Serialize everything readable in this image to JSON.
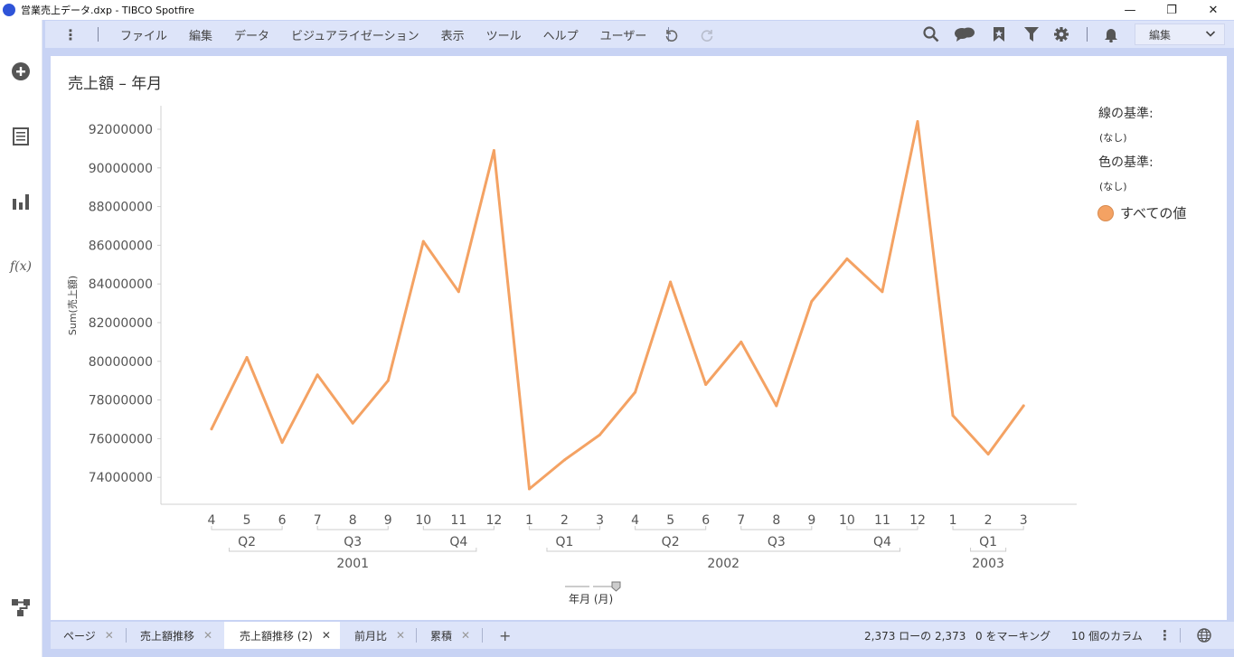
{
  "window": {
    "title": "営業売上データ.dxp - TIBCO Spotfire",
    "controls": [
      "—",
      "❐",
      "✕"
    ]
  },
  "sidebar": {
    "icons": [
      "add-icon",
      "data-table-icon",
      "visualization-icon",
      "expression-icon",
      "data-canvas-icon"
    ],
    "fx_label": "f(x)"
  },
  "menu": {
    "kebab": "⋮",
    "items": [
      "ファイル",
      "編集",
      "データ",
      "ビジュアライゼーション",
      "表示",
      "ツール",
      "ヘルプ",
      "ユーザー"
    ],
    "edit_mode": "編集"
  },
  "visualization": {
    "title": "売上額 – 年月",
    "color_accent": "#f4a263",
    "legend": {
      "line_by_label": "線の基準:",
      "line_by_value": "(なし)",
      "color_by_label": "色の基準:",
      "color_by_value": "(なし)",
      "item_label": "すべての値"
    },
    "axis_selector_label": "年月 (月)"
  },
  "chart_data": {
    "type": "line",
    "title": "売上額 – 年月",
    "ylabel": "Sum(売上額)",
    "xlabel": "年月 (月)",
    "ylim": [
      72500000,
      93500000
    ],
    "yticks": [
      74000000,
      76000000,
      78000000,
      80000000,
      82000000,
      84000000,
      86000000,
      88000000,
      90000000,
      92000000
    ],
    "x": [
      {
        "year": "2001",
        "quarter": "Q2",
        "month": "4"
      },
      {
        "year": "2001",
        "quarter": "Q2",
        "month": "5"
      },
      {
        "year": "2001",
        "quarter": "Q2",
        "month": "6"
      },
      {
        "year": "2001",
        "quarter": "Q3",
        "month": "7"
      },
      {
        "year": "2001",
        "quarter": "Q3",
        "month": "8"
      },
      {
        "year": "2001",
        "quarter": "Q3",
        "month": "9"
      },
      {
        "year": "2001",
        "quarter": "Q4",
        "month": "10"
      },
      {
        "year": "2001",
        "quarter": "Q4",
        "month": "11"
      },
      {
        "year": "2001",
        "quarter": "Q4",
        "month": "12"
      },
      {
        "year": "2002",
        "quarter": "Q1",
        "month": "1"
      },
      {
        "year": "2002",
        "quarter": "Q1",
        "month": "2"
      },
      {
        "year": "2002",
        "quarter": "Q1",
        "month": "3"
      },
      {
        "year": "2002",
        "quarter": "Q2",
        "month": "4"
      },
      {
        "year": "2002",
        "quarter": "Q2",
        "month": "5"
      },
      {
        "year": "2002",
        "quarter": "Q2",
        "month": "6"
      },
      {
        "year": "2002",
        "quarter": "Q3",
        "month": "7"
      },
      {
        "year": "2002",
        "quarter": "Q3",
        "month": "8"
      },
      {
        "year": "2002",
        "quarter": "Q3",
        "month": "9"
      },
      {
        "year": "2002",
        "quarter": "Q4",
        "month": "10"
      },
      {
        "year": "2002",
        "quarter": "Q4",
        "month": "11"
      },
      {
        "year": "2002",
        "quarter": "Q4",
        "month": "12"
      },
      {
        "year": "2003",
        "quarter": "Q1",
        "month": "1"
      },
      {
        "year": "2003",
        "quarter": "Q1",
        "month": "2"
      },
      {
        "year": "2003",
        "quarter": "Q1",
        "month": "3"
      }
    ],
    "series": [
      {
        "values": [
          76500000,
          80200000,
          75800000,
          79300000,
          76800000,
          79000000,
          86200000,
          83600000,
          90900000,
          73400000,
          74900000,
          76200000,
          78400000,
          84100000,
          78800000,
          81000000,
          77700000,
          83100000,
          85300000,
          83600000,
          92400000,
          77200000,
          75200000,
          77700000
        ],
        "color": "#f4a263"
      }
    ],
    "grid": false,
    "legend_position": "right"
  },
  "tabs": [
    {
      "label": "ページ",
      "active": false
    },
    {
      "label": "売上額推移",
      "active": false
    },
    {
      "label": "売上額推移 (2)",
      "active": true
    },
    {
      "label": "前月比",
      "active": false
    },
    {
      "label": "累積",
      "active": false
    }
  ],
  "tab_add": "+",
  "tab_close": "✕",
  "status": {
    "rows": "2,373 ローの 2,373",
    "marked": "0 をマーキング",
    "columns": "10 個のカラム",
    "kebab": "⋮"
  }
}
